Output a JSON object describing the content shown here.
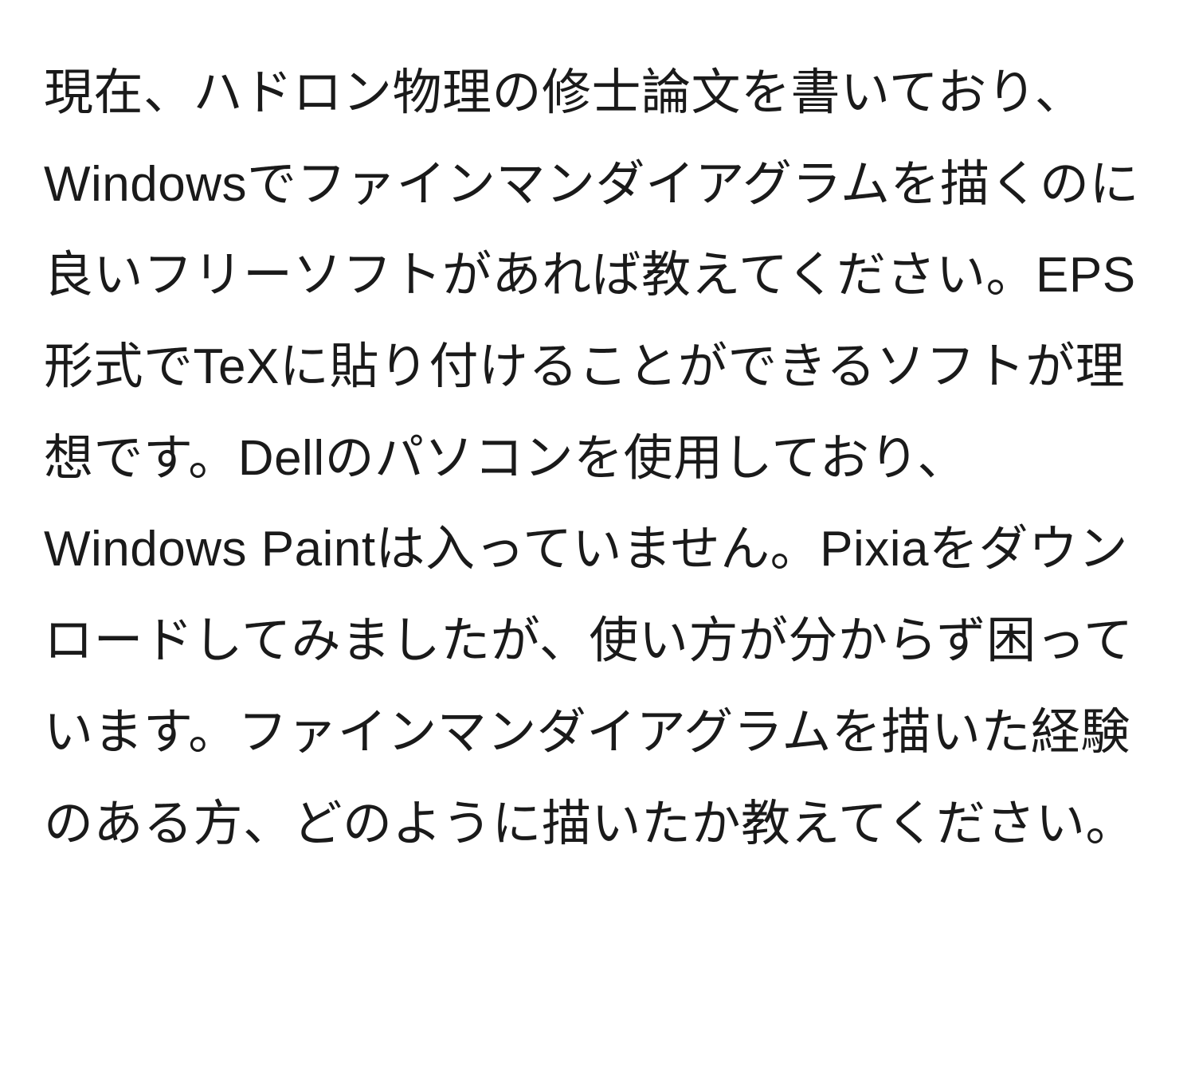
{
  "paragraph": {
    "text": "現在、ハドロン物理の修士論文を書いており、Windowsでファインマンダイアグラムを描くのに良いフリーソフトがあれば教えてください。EPS形式でTeXに貼り付けることができるソフトが理想です。Dellのパソコンを使用しており、Windows Paintは入っていません。Pixiaをダウンロードしてみましたが、使い方が分からず困っています。ファインマンダイアグラムを描いた経験のある方、どのように描いたか教えてください。"
  }
}
